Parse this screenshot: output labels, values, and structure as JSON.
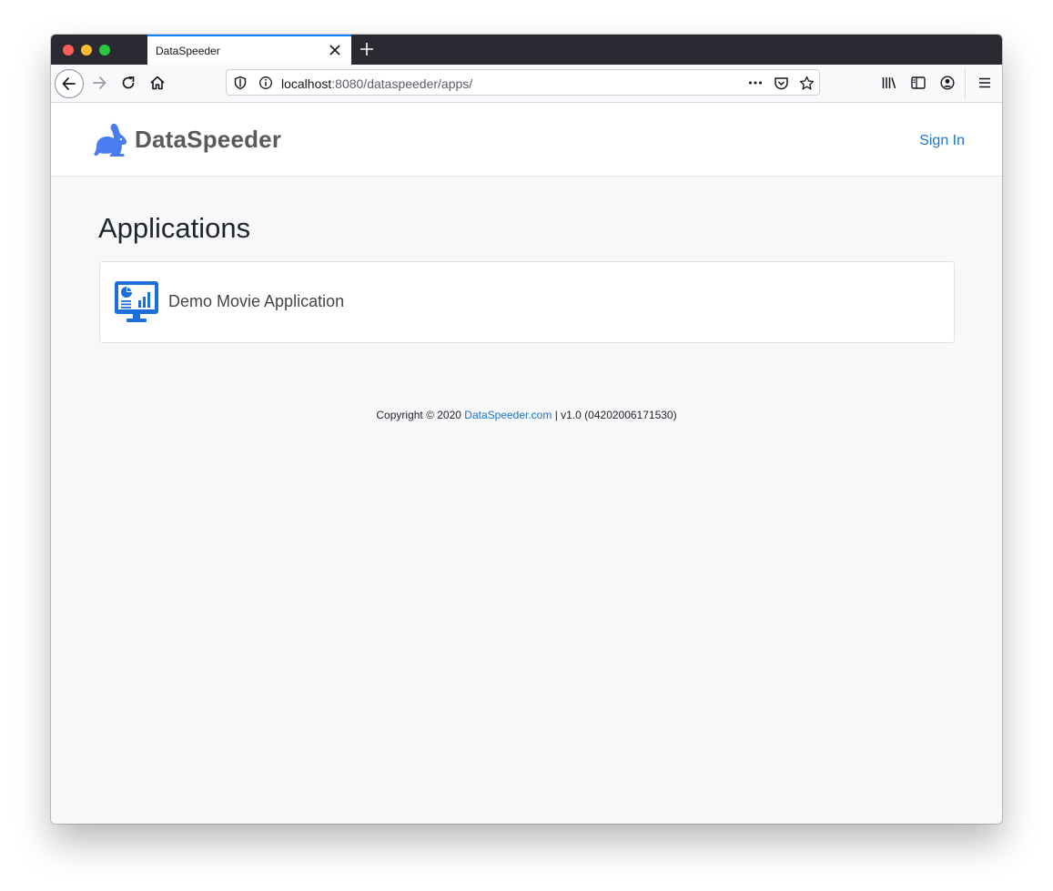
{
  "browser": {
    "tab_title": "DataSpeeder",
    "url_host": "localhost",
    "url_rest": ":8080/dataspeeder/apps/",
    "icons": [
      "back-arrow-icon",
      "forward-arrow-icon",
      "reload-icon",
      "home-icon",
      "shield-icon",
      "info-icon",
      "more-icon",
      "pocket-icon",
      "bookmark-star-icon",
      "library-icon",
      "sidebar-icon",
      "account-icon",
      "menu-icon",
      "close-icon",
      "plus-icon"
    ]
  },
  "header": {
    "brand_name": "DataSpeeder",
    "sign_in": "Sign In"
  },
  "main": {
    "title": "Applications",
    "apps": [
      {
        "name": "Demo Movie Application",
        "icon": "dashboard-monitor-icon"
      }
    ]
  },
  "footer": {
    "copyright": "Copyright © 2020",
    "link": "DataSpeeder.com",
    "version": "| v1.0 (04202006171530)"
  },
  "colors": {
    "accent": "#1a73c8",
    "brand_blue": "#4a7df0",
    "app_icon_blue": "#1a6fdc"
  }
}
